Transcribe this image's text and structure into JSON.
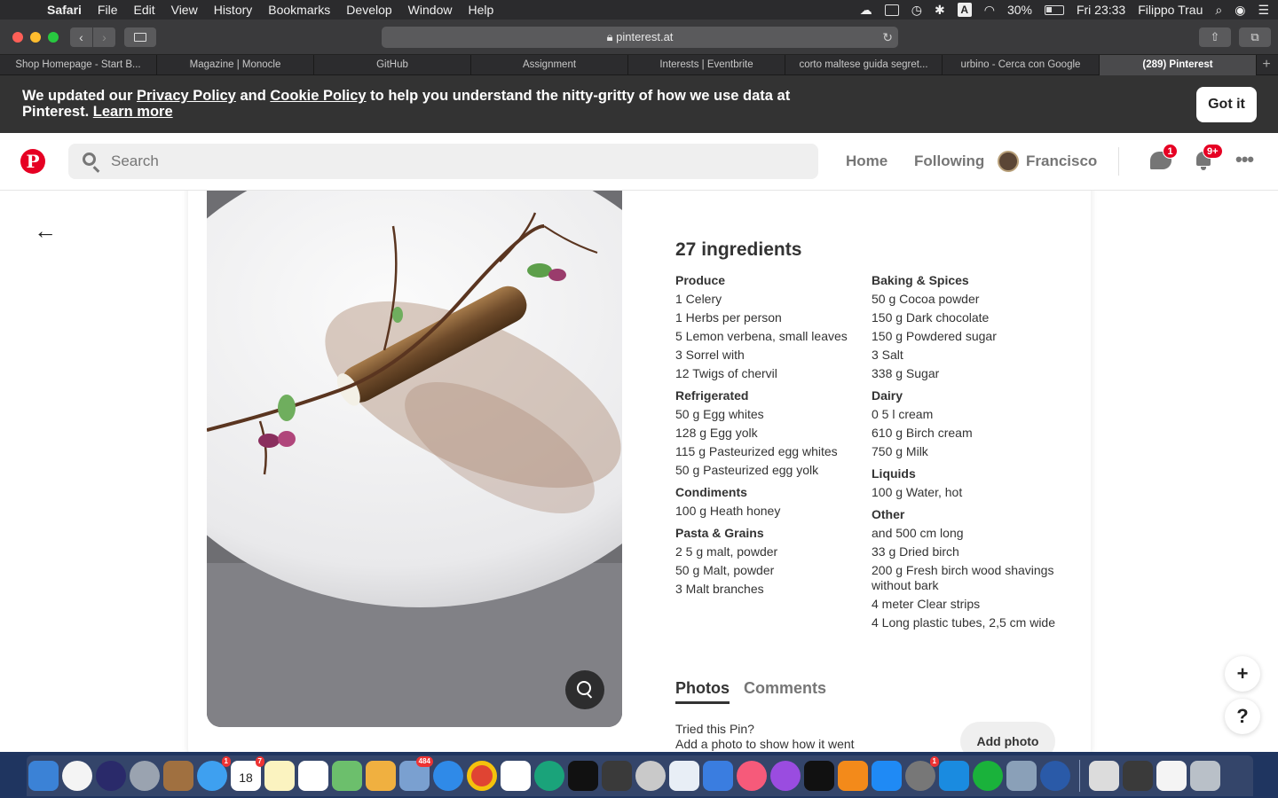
{
  "menubar": {
    "app": "Safari",
    "items": [
      "File",
      "Edit",
      "View",
      "History",
      "Bookmarks",
      "Develop",
      "Window",
      "Help"
    ],
    "battery": "30%",
    "clock": "Fri 23:33",
    "user": "Filippo Trau"
  },
  "toolbar": {
    "url": "pinterest.at"
  },
  "tabs": [
    {
      "label": "Shop Homepage - Start B..."
    },
    {
      "label": "Magazine | Monocle"
    },
    {
      "label": "GitHub"
    },
    {
      "label": "Assignment"
    },
    {
      "label": "Interests | Eventbrite"
    },
    {
      "label": "corto maltese guida segret..."
    },
    {
      "label": "urbino - Cerca con Google"
    },
    {
      "label": "(289) Pinterest"
    }
  ],
  "banner": {
    "text_before": "We updated our ",
    "privacy_link": "Privacy Policy",
    "text_and": " and ",
    "cookie_link": "Cookie Policy",
    "text_after": " to help you understand the nitty-gritty of how we use data at Pinterest. ",
    "learn_more": "Learn more",
    "got_it": "Got it"
  },
  "header": {
    "logo": "P",
    "search_placeholder": "Search",
    "home": "Home",
    "following": "Following",
    "user": "Francisco",
    "messages_badge": "1",
    "notifications_badge": "9+"
  },
  "pin": {
    "ingredients_title": "27 ingredients",
    "left_column": [
      {
        "category": "Produce",
        "items": [
          "1 Celery",
          "1 Herbs per person",
          "5 Lemon verbena, small leaves",
          "3 Sorrel with",
          "12 Twigs of chervil"
        ]
      },
      {
        "category": "Refrigerated",
        "items": [
          "50 g Egg whites",
          "128 g Egg yolk",
          "115 g Pasteurized egg whites",
          "50 g Pasteurized egg yolk"
        ]
      },
      {
        "category": "Condiments",
        "items": [
          "100 g Heath honey"
        ]
      },
      {
        "category": "Pasta & Grains",
        "items": [
          "2 5 g malt, powder",
          "50 g Malt, powder",
          "3 Malt branches"
        ]
      }
    ],
    "right_column": [
      {
        "category": "Baking & Spices",
        "items": [
          "50 g Cocoa powder",
          "150 g Dark chocolate",
          "150 g Powdered sugar",
          "3 Salt",
          "338 g Sugar"
        ]
      },
      {
        "category": "Dairy",
        "items": [
          "0 5 l cream",
          "610 g Birch cream",
          "750 g Milk"
        ]
      },
      {
        "category": "Liquids",
        "items": [
          "100 g Water, hot"
        ]
      },
      {
        "category": "Other",
        "items": [
          "and 500 cm long",
          "33 g Dried birch",
          "200 g Fresh birch wood shavings without bark",
          "4 meter Clear strips",
          "4 Long plastic tubes, 2,5 cm wide"
        ]
      }
    ],
    "tab_photos": "Photos",
    "tab_comments": "Comments",
    "tried_line1": "Tried this Pin?",
    "tried_line2": "Add a photo to show how it went",
    "add_photo": "Add photo"
  },
  "fabs": {
    "plus": "+",
    "help": "?"
  },
  "dock": {
    "badges": {
      "messages": "1",
      "calendar": "7",
      "preview": "484",
      "system_prefs": "1"
    },
    "calendar_day": "18"
  }
}
